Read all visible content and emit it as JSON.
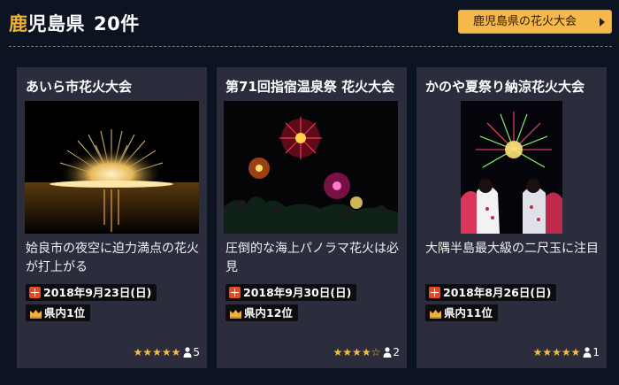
{
  "header": {
    "pref_first": "鹿",
    "pref_rest": "児島県",
    "count": "20件",
    "button_label": "鹿児島県の花火大会"
  },
  "cards": [
    {
      "title": "あいら市花火大会",
      "desc": "姶良市の夜空に迫力満点の花火が打上がる",
      "date": "2018年9月23日(日)",
      "rank": "県内1位",
      "stars": "★★★★★",
      "rating_value": 5,
      "reviews": "5",
      "image_icon": "fireworks-over-water-photo"
    },
    {
      "title": "第71回指宿温泉祭 花火大会",
      "desc": "圧倒的な海上パノラマ花火は必見",
      "date": "2018年9月30日(日)",
      "rank": "県内12位",
      "stars": "★★★★☆",
      "rating_value": 4,
      "reviews": "2",
      "image_icon": "fireworks-crowd-photo"
    },
    {
      "title": "かのや夏祭り納涼花火大会",
      "desc": "大隅半島最大級の二尺玉に注目",
      "date": "2018年8月26日(日)",
      "rank": "県内11位",
      "stars": "★★★★★",
      "rating_value": 5,
      "reviews": "1",
      "image_icon": "fireworks-yukata-photo"
    }
  ],
  "colors": {
    "background": "#0c1422",
    "card": "#2b2d3d",
    "accent": "#f3b233",
    "button": "#f5b84a",
    "star": "#f7be3b",
    "calendar": "#e34b28"
  }
}
